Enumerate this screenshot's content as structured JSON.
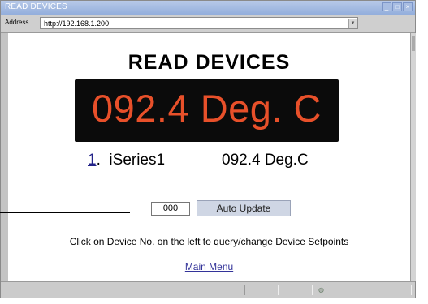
{
  "window": {
    "title": "READ DEVICES",
    "controls": [
      "_",
      "□",
      "×"
    ]
  },
  "address_bar": {
    "label": "Address",
    "url": "http://192.168.1.200",
    "dropdown": "▾"
  },
  "page": {
    "title": "READ DEVICES",
    "display": {
      "value": "092.4 Deg. C",
      "color": "#e8502a"
    },
    "device": {
      "number": "1",
      "number_suffix": ".",
      "name": "iSeries1",
      "reading": "092.4 Deg.C"
    },
    "interval_value": "000",
    "auto_update_label": "Auto Update",
    "hint": "Click on Device No. on the left to query/change Device Setpoints",
    "main_menu_label": "Main Menu"
  },
  "status_bar": {
    "zone_icon": "◍"
  },
  "icons": {
    "window-controls": [
      "minimize-icon",
      "maximize-icon",
      "close-icon"
    ],
    "status": "network-zone-icon"
  }
}
